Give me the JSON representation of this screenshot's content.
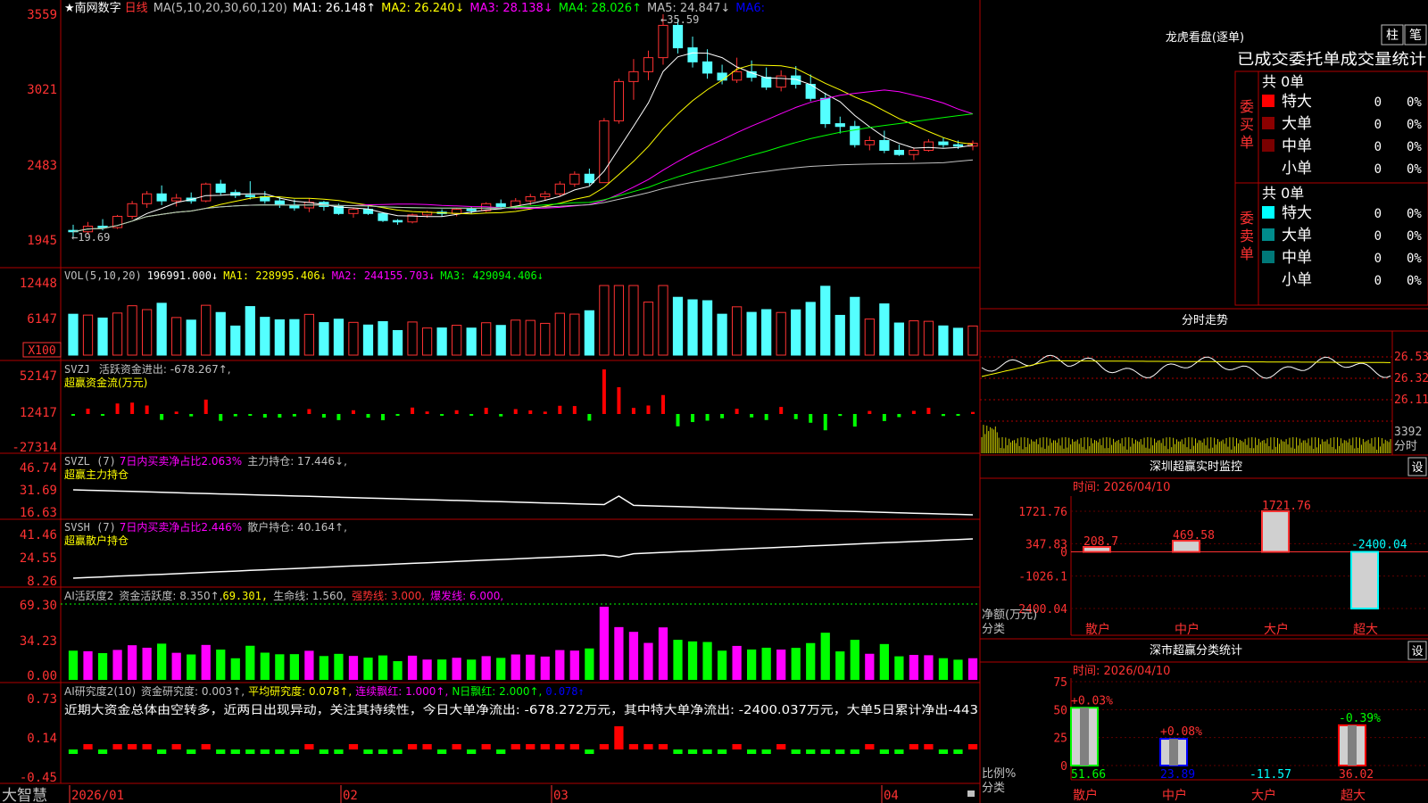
{
  "stock_name": "南网数字",
  "period": "日线",
  "ma_header": {
    "label": "MA(5,10,20,30,60,120)",
    "ma1": "MA1: 26.148↑",
    "ma2": "MA2: 26.240↓",
    "ma3": "MA3: 28.138↓",
    "ma4": "MA4: 28.026↑",
    "ma5": "MA5: 24.847↓",
    "ma6": "MA6:"
  },
  "price_axis": [
    "3559",
    "3021",
    "2483",
    "1945"
  ],
  "price_high_label": "35.59",
  "price_low_label": "19.69",
  "vol_header": {
    "label": "VOL(5,10,20)",
    "vol": "196991.000↓",
    "ma1": "MA1: 228995.406↓",
    "ma2": "MA2: 244155.703↓",
    "ma3": "MA3: 429094.406↓"
  },
  "vol_axis": [
    "12448",
    "6147"
  ],
  "vol_unit": "X100",
  "svzj": {
    "name": "SVZJ",
    "label": "活跃资金进出: -678.267↑,",
    "subtitle": "超赢资金流(万元)",
    "axis": [
      "52147",
      "12417",
      "-27314"
    ]
  },
  "svzl": {
    "name": "SVZL (7)",
    "ratio": "7日内买卖净占比2.063%",
    "hold": "主力持仓: 17.446↓,",
    "subtitle": "超赢主力持仓",
    "axis": [
      "46.74",
      "31.69",
      "16.63"
    ]
  },
  "svsh": {
    "name": "SVSH (7)",
    "ratio": "7日内买卖净占比2.446%",
    "hold": "散户持仓: 40.164↑,",
    "subtitle": "超赢散户持仓",
    "axis": [
      "41.46",
      "24.55",
      "8.26"
    ]
  },
  "ai_active": {
    "name": "AI活跃度2",
    "v1": "资金活跃度: 8.350↑,",
    "v2": "69.301,",
    "v3": "生命线: 1.560,",
    "v4": "强势线: 3.000,",
    "v5": "爆发线: 6.000,",
    "axis": [
      "69.30",
      "34.23",
      "0.00"
    ]
  },
  "ai_research": {
    "name": "AI研究度2(10)",
    "v1": "资金研究度: 0.003↑,",
    "v2": "平均研究度: 0.078↑,",
    "v3": "连续飘红: 1.000↑,",
    "v4": "N日飘红: 2.000↑,",
    "v5": "0.078↑",
    "desc": "近期大资金总体由空转多，近两日出现异动，关注其持续性，今日大单净流出: -678.272万元，其中特大单净流出: -2400.037万元，大单5日累计净出-443",
    "axis": [
      "0.73",
      "0.14",
      "-0.45"
    ]
  },
  "x_axis": [
    "2026/01",
    "02",
    "03",
    "04"
  ],
  "footer_brand": "大智慧",
  "colors": {
    "up": "#ff3232",
    "down": "#54ffff",
    "ma1": "#ffffff",
    "ma2": "#ffff00",
    "ma3": "#ff00ff",
    "ma4": "#00ff00",
    "ma5": "#c0c0c0",
    "ma6": "#0000ff",
    "axis": "#ff3232"
  },
  "chart_data": [
    {
      "type": "candlestick",
      "title": "南网数字 日线",
      "ylim": [
        19.45,
        35.59
      ],
      "ohlc": [
        [
          20.2,
          20.6,
          19.69,
          20.1
        ],
        [
          20.1,
          20.8,
          19.9,
          20.5
        ],
        [
          20.5,
          21.0,
          20.2,
          20.4
        ],
        [
          20.4,
          21.3,
          20.3,
          21.2
        ],
        [
          21.2,
          22.3,
          21.0,
          22.1
        ],
        [
          22.1,
          23.0,
          21.8,
          22.8
        ],
        [
          22.8,
          23.4,
          22.0,
          22.3
        ],
        [
          22.3,
          22.8,
          21.9,
          22.5
        ],
        [
          22.5,
          22.9,
          22.1,
          22.3
        ],
        [
          22.3,
          23.6,
          22.2,
          23.5
        ],
        [
          23.5,
          23.8,
          22.7,
          22.9
        ],
        [
          22.9,
          23.1,
          22.5,
          22.7
        ],
        [
          22.7,
          23.7,
          22.4,
          22.6
        ],
        [
          22.6,
          23.0,
          22.1,
          22.3
        ],
        [
          22.3,
          22.6,
          21.8,
          22.0
        ],
        [
          22.0,
          22.4,
          21.6,
          21.8
        ],
        [
          21.8,
          22.5,
          21.5,
          22.2
        ],
        [
          22.2,
          22.3,
          21.6,
          21.9
        ],
        [
          21.9,
          22.1,
          21.3,
          21.4
        ],
        [
          21.4,
          21.8,
          21.1,
          21.7
        ],
        [
          21.7,
          21.9,
          21.3,
          21.4
        ],
        [
          21.4,
          21.5,
          20.8,
          20.9
        ],
        [
          20.9,
          21.0,
          20.6,
          20.8
        ],
        [
          20.8,
          21.4,
          20.7,
          21.3
        ],
        [
          21.3,
          21.6,
          21.1,
          21.5
        ],
        [
          21.5,
          21.7,
          21.2,
          21.4
        ],
        [
          21.4,
          21.8,
          21.2,
          21.7
        ],
        [
          21.7,
          21.9,
          21.4,
          21.6
        ],
        [
          21.6,
          22.2,
          21.5,
          22.1
        ],
        [
          22.1,
          22.4,
          21.8,
          21.9
        ],
        [
          21.9,
          22.5,
          21.7,
          22.3
        ],
        [
          22.3,
          22.8,
          22.0,
          22.6
        ],
        [
          22.6,
          23.0,
          22.3,
          22.8
        ],
        [
          22.8,
          23.7,
          22.6,
          23.5
        ],
        [
          23.5,
          24.4,
          23.3,
          24.2
        ],
        [
          24.2,
          24.6,
          23.4,
          23.6
        ],
        [
          23.6,
          28.2,
          23.6,
          28.0
        ],
        [
          28.0,
          31.0,
          27.8,
          30.8
        ],
        [
          30.8,
          32.4,
          29.5,
          31.5
        ],
        [
          31.5,
          33.0,
          30.9,
          32.5
        ],
        [
          32.5,
          35.59,
          32.0,
          34.8
        ],
        [
          34.8,
          35.2,
          32.8,
          33.2
        ],
        [
          33.2,
          34.0,
          31.8,
          32.2
        ],
        [
          32.2,
          33.1,
          31.0,
          31.4
        ],
        [
          31.4,
          32.0,
          30.6,
          30.9
        ],
        [
          30.9,
          32.5,
          30.7,
          31.5
        ],
        [
          31.5,
          32.3,
          30.8,
          31.1
        ],
        [
          31.1,
          31.8,
          30.2,
          30.4
        ],
        [
          30.4,
          31.6,
          30.1,
          31.2
        ],
        [
          31.2,
          31.9,
          30.3,
          30.6
        ],
        [
          30.6,
          31.3,
          29.4,
          29.6
        ],
        [
          29.6,
          30.0,
          27.5,
          27.8
        ],
        [
          27.8,
          28.3,
          27.1,
          27.6
        ],
        [
          27.6,
          28.0,
          26.1,
          26.3
        ],
        [
          26.3,
          26.9,
          25.9,
          26.6
        ],
        [
          26.6,
          27.3,
          25.7,
          25.9
        ],
        [
          25.9,
          26.3,
          25.5,
          25.6
        ],
        [
          25.6,
          26.1,
          25.2,
          25.9
        ],
        [
          25.9,
          26.7,
          25.8,
          26.5
        ],
        [
          26.5,
          26.8,
          26.1,
          26.3
        ],
        [
          26.3,
          26.6,
          26.0,
          26.2
        ],
        [
          26.2,
          26.6,
          25.9,
          26.4
        ]
      ]
    }
  ],
  "right_panel": {
    "top_title": "龙虎看盘(逐单)",
    "btn_zhu": "柱",
    "btn_bi": "笔",
    "stats_title": "已成交委托单成交量统计",
    "buy_label": [
      "委",
      "买",
      "单"
    ],
    "sell_label": [
      "委",
      "卖",
      "单"
    ],
    "buy_total": "共 0单",
    "sell_total": "共 0单",
    "buy_rows": [
      {
        "name": "特大",
        "val": "0",
        "pct": "0%",
        "color": "#ff0000"
      },
      {
        "name": "大单",
        "val": "0",
        "pct": "0%",
        "color": "#8b0000"
      },
      {
        "name": "中单",
        "val": "0",
        "pct": "0%",
        "color": "#7a0000"
      },
      {
        "name": "小单",
        "val": "0",
        "pct": "0%",
        "color": "#000000"
      }
    ],
    "sell_rows": [
      {
        "name": "特大",
        "val": "0",
        "pct": "0%",
        "color": "#00ffff"
      },
      {
        "name": "大单",
        "val": "0",
        "pct": "0%",
        "color": "#008b8b"
      },
      {
        "name": "中单",
        "val": "0",
        "pct": "0%",
        "color": "#007878"
      },
      {
        "name": "小单",
        "val": "0",
        "pct": "0%",
        "color": "#000000"
      }
    ],
    "intraday_title": "分时走势",
    "intraday_axis": [
      "26.53",
      "26.32",
      "26.11"
    ],
    "intraday_vol": "3392",
    "intraday_vol_unit": "分时",
    "sz_monitor": {
      "title": "深圳超赢实时监控",
      "btn": "设",
      "time_label": "时间: 2026/04/10",
      "ylabel": "净额(万元)",
      "xlabel": "分类",
      "axis": [
        "1721.76",
        "347.83",
        "0",
        "-1026.1",
        "-2400.04"
      ],
      "categories": [
        "散户",
        "中户",
        "大户",
        "超大"
      ],
      "values": [
        208.7,
        469.58,
        1721.76,
        -2400.04
      ],
      "value_labels": [
        "208.7",
        "469.58",
        "1721.76",
        "-2400.04"
      ]
    },
    "sz_class": {
      "title": "深市超赢分类统计",
      "btn": "设",
      "time_label": "时间: 2026/04/10",
      "ylabel": "比例%",
      "xlabel": "分类",
      "axis": [
        "75",
        "50",
        "25",
        "0"
      ],
      "categories": [
        "散户",
        "中户",
        "大户",
        "超大"
      ],
      "values": [
        51.66,
        23.89,
        -11.57,
        36.02
      ],
      "value_labels": [
        "51.66",
        "23.89",
        "-11.57",
        "36.02"
      ],
      "changes": [
        "+0.03%",
        "+0.08%",
        "",
        "-0.39%"
      ]
    }
  }
}
